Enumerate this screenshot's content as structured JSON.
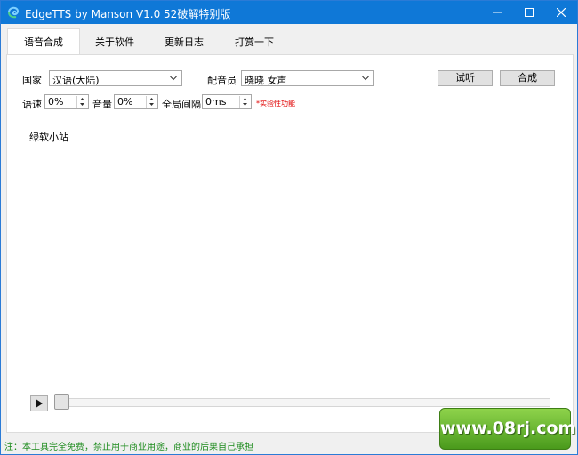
{
  "window": {
    "title": "EdgeTTS by Manson V1.0 52破解特别版"
  },
  "tabs": [
    {
      "label": "语音合成",
      "active": true
    },
    {
      "label": "关于软件",
      "active": false
    },
    {
      "label": "更新日志",
      "active": false
    },
    {
      "label": "打赏一下",
      "active": false
    }
  ],
  "form": {
    "country_label": "国家",
    "country_value": "汉语(大陆)",
    "voice_label": "配音员",
    "voice_value": "晓晓 女声",
    "listen_button": "试听",
    "synth_button": "合成",
    "rate_label": "语速",
    "rate_value": "0%",
    "volume_label": "音量",
    "volume_value": "0%",
    "gap_label": "全局间隔",
    "gap_value": "0ms",
    "experimental_note": "*实验性功能"
  },
  "editor": {
    "text": "绿软小站"
  },
  "player": {
    "progress": 0
  },
  "status": {
    "text": "注：本工具完全免费，禁止用于商业用途，商业的后果自己承担"
  },
  "watermark": {
    "text": "www.08rj.com"
  },
  "colors": {
    "titlebar": "#0f78d7",
    "status_text": "#1a8a1a",
    "note_text": "#e00000"
  }
}
